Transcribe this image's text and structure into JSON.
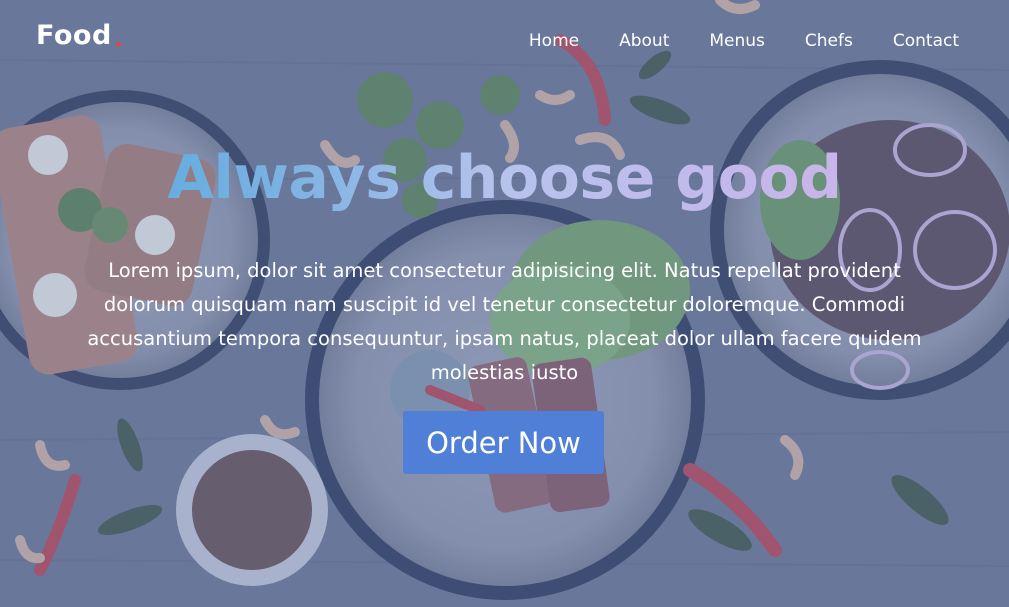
{
  "header": {
    "logo": "Food",
    "nav": [
      "Home",
      "About",
      "Menus",
      "Chefs",
      "Contact"
    ]
  },
  "hero": {
    "title": "Always choose good",
    "text": "Lorem ipsum, dolor sit amet consectetur adipisicing elit. Natus repellat provident dolorum quisquam nam suscipit id vel tenetur consectetur doloremque. Commodi accusantium tempora consequuntur, ipsam natus, placeat dolor ullam facere quidem molestias iusto",
    "cta": "Order Now"
  },
  "colors": {
    "accent": "#4f7fd6",
    "title_gradient_start": "#48a6dc",
    "title_gradient_end": "#cdb3ea"
  }
}
